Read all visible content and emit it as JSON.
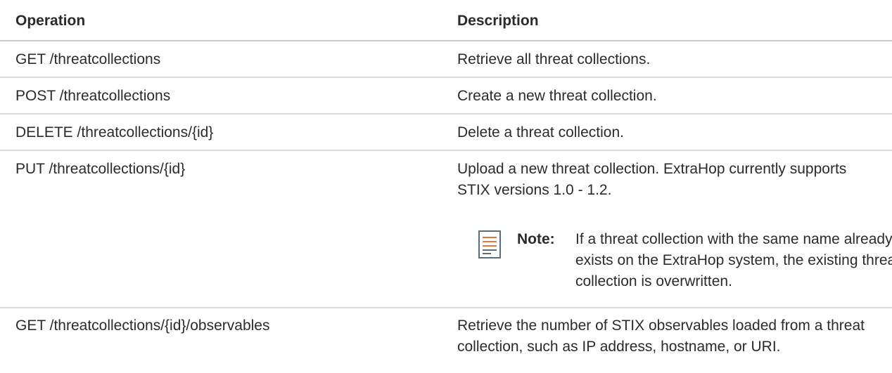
{
  "table": {
    "headers": {
      "operation": "Operation",
      "description": "Description"
    },
    "rows": [
      {
        "operation": "GET /threatcollections",
        "description": "Retrieve all threat collections."
      },
      {
        "operation": "POST /threatcollections",
        "description": "Create a new threat collection."
      },
      {
        "operation": "DELETE /threatcollections/{id}",
        "description": "Delete a threat collection."
      },
      {
        "operation": "PUT /threatcollections/{id}",
        "description": "Upload a new threat collection. ExtraHop currently supports STIX versions 1.0 - 1.2.",
        "note": {
          "label": "Note:",
          "icon": "note-document-icon",
          "text": "If a threat collection with the same name already exists on the ExtraHop system, the existing threat collection is overwritten."
        }
      },
      {
        "operation": "GET /threatcollections/{id}/observables",
        "description": "Retrieve the number of STIX observables loaded from a threat collection, such as IP address, hostname, or URI."
      }
    ]
  },
  "colors": {
    "text": "#2b2b2b",
    "rule": "#d9d9d9",
    "note_icon_accent": "#e8743b",
    "note_icon_frame": "#5a6b7a"
  }
}
